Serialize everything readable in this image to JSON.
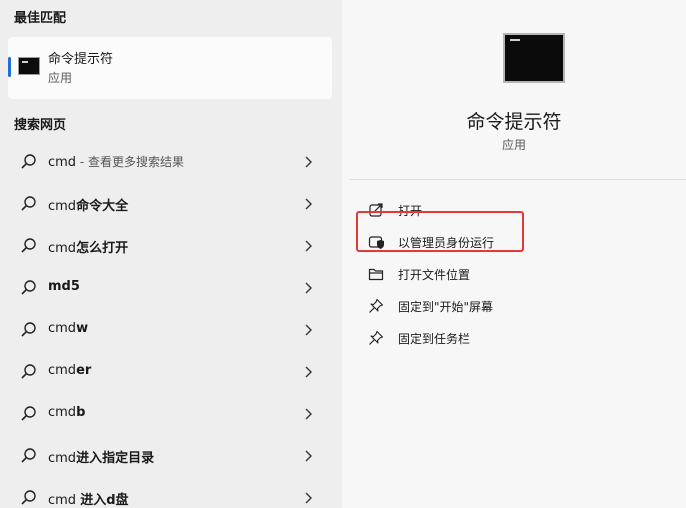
{
  "left": {
    "best_match_title": "最佳匹配",
    "best_match": {
      "name": "命令提示符",
      "type": "应用"
    },
    "web_title": "搜索网页",
    "web_items": [
      {
        "pre": "cmd",
        "bold": "",
        "sub": " - 查看更多搜索结果"
      },
      {
        "pre": "cmd",
        "bold": "命令大全",
        "sub": ""
      },
      {
        "pre": "cmd",
        "bold": "怎么打开",
        "sub": ""
      },
      {
        "pre": "",
        "bold": "md5",
        "sub": ""
      },
      {
        "pre": "cmd",
        "bold": "w",
        "sub": ""
      },
      {
        "pre": "cmd",
        "bold": "er",
        "sub": ""
      },
      {
        "pre": "cmd",
        "bold": "b",
        "sub": ""
      },
      {
        "pre": "cmd",
        "bold": "进入指定目录",
        "sub": ""
      },
      {
        "pre": "cmd ",
        "bold": "进入d盘",
        "sub": ""
      }
    ]
  },
  "right": {
    "app_title": "命令提示符",
    "app_type": "应用",
    "actions": [
      {
        "label": "打开",
        "icon": "open-external-icon"
      },
      {
        "label": "以管理员身份运行",
        "icon": "run-as-admin-shield-icon"
      },
      {
        "label": "打开文件位置",
        "icon": "folder-icon"
      },
      {
        "label": "固定到\"开始\"屏幕",
        "icon": "pin-icon"
      },
      {
        "label": "固定到任务栏",
        "icon": "pin-icon"
      }
    ]
  },
  "colors": {
    "accent": "#1f6fd6",
    "highlight": "#e53935"
  }
}
